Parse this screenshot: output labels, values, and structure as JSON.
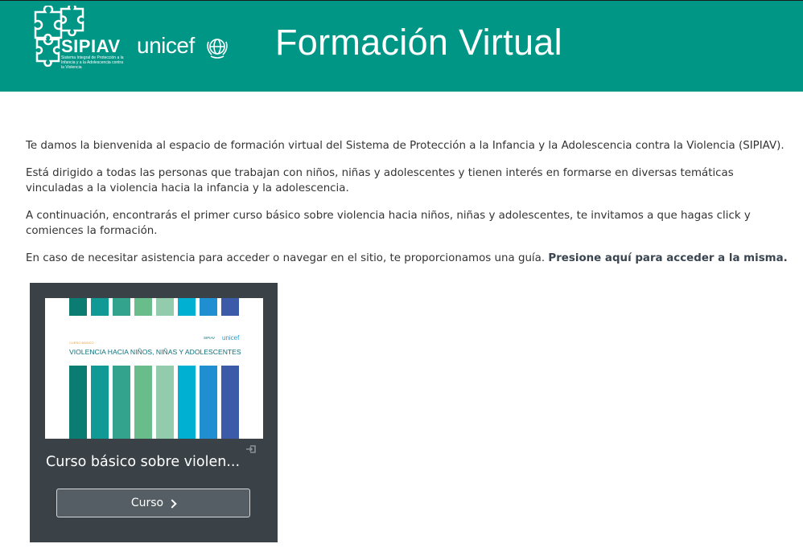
{
  "header": {
    "brand_name": "SIPIAV",
    "brand_subtitle": "Sistema Integral de Protección a la Infancia y a la Adolescencia contra la Violencia",
    "partner_name": "unicef",
    "title": "Formación Virtual",
    "background_color": "#009686"
  },
  "intro": {
    "paragraph_1": "Te damos la bienvenida al espacio de formación virtual del Sistema de Protección a la Infancia y la Adolescencia contra la Violencia (SIPIAV).",
    "paragraph_2": "Está dirigido a todas las personas que trabajan con niños, niñas y adolescentes y tienen interés en formarse en diversas temáticas vinculadas a la violencia hacia la infancia y la adolescencia.",
    "paragraph_3": "A continuación, encontrarás el primer curso básico sobre violencia hacia niños, niñas y adolescentes, te invitamos a que hagas click y comiences la formación.",
    "paragraph_4": "En caso de necesitar asistencia para acceder o navegar en el sitio, te proporcionamos una guía.",
    "guide_link": "Presione aquí para acceder a la misma."
  },
  "course_card": {
    "image": {
      "kicker": "CURSO BÁSICO",
      "headline": "VIOLENCIA HACIA NIÑOS, NIÑAS Y ADOLESCENTES",
      "logo_sipiav": "SIPIAV",
      "logo_unicef": "unicef",
      "stripe_colors": [
        "#0a7c72",
        "#109995",
        "#34a38e",
        "#68bd8b",
        "#93cbad",
        "#00b0d3",
        "#1f8fd1",
        "#3b5aa8"
      ]
    },
    "enter_icon": "enter-icon",
    "title": "Curso básico sobre violen...",
    "button_label": "Curso",
    "button_icon": "chevron-right-icon"
  }
}
